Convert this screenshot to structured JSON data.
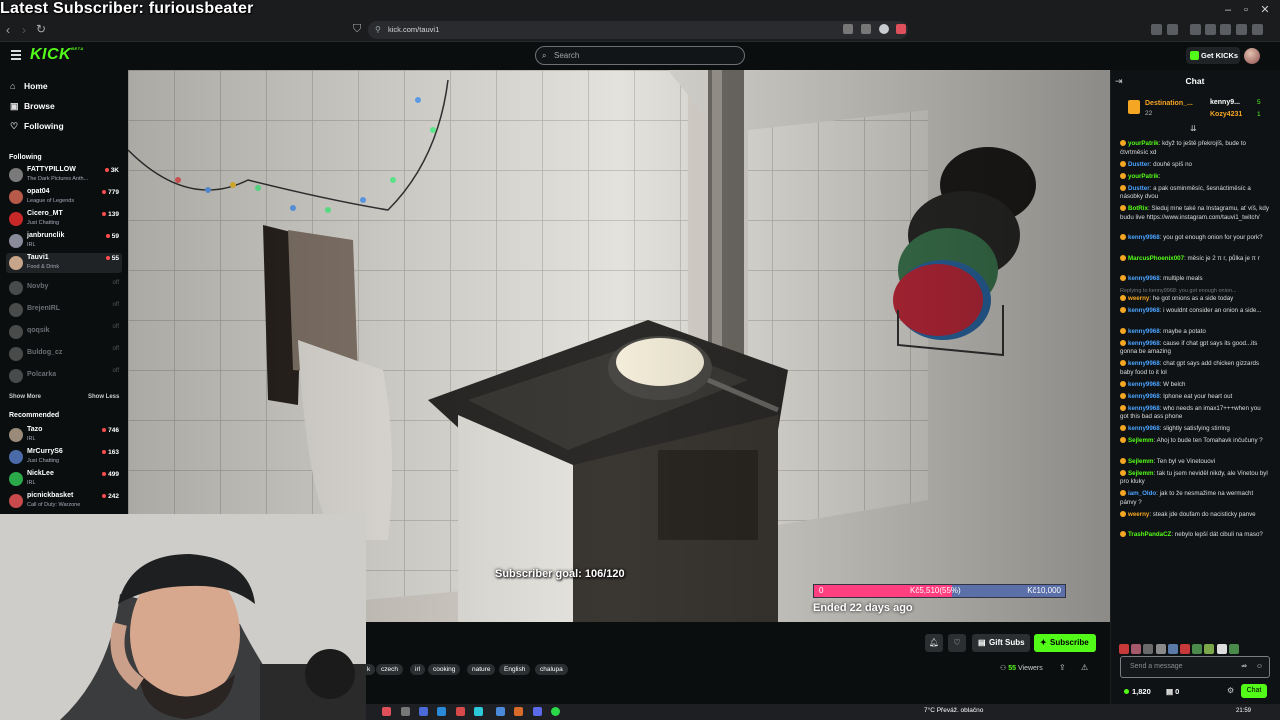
{
  "overlay": {
    "latest_subscriber": "Latest Subscriber: furiousbeater"
  },
  "browser": {
    "url": "kick.com/tauvi1"
  },
  "header": {
    "logo": "KICK",
    "search_placeholder": "Search",
    "get_kicks": "Get KICKs"
  },
  "sidebar": {
    "nav": [
      {
        "label": "Home",
        "icon": "home-icon"
      },
      {
        "label": "Browse",
        "icon": "browse-icon"
      },
      {
        "label": "Following",
        "icon": "heart-icon"
      }
    ],
    "following_title": "Following",
    "following": [
      {
        "name": "FATTYPILLOW",
        "category": "The Dark Pictures Anth...",
        "viewers": "3K",
        "color": "#7a7a7a"
      },
      {
        "name": "opat04",
        "category": "League of Legends",
        "viewers": "779",
        "color": "#b85a4a"
      },
      {
        "name": "Cicero_MT",
        "category": "Just Chatting",
        "viewers": "139",
        "color": "#c82828"
      },
      {
        "name": "janbrunclik",
        "category": "IRL",
        "viewers": "59",
        "color": "#8a8a9a"
      },
      {
        "name": "Tauvi1",
        "category": "Food & Drink",
        "viewers": "55",
        "color": "#c7a58a"
      }
    ],
    "offline": [
      {
        "name": "Novby",
        "status": "off"
      },
      {
        "name": "BrejenIRL",
        "status": "off"
      },
      {
        "name": "qoqsik",
        "status": "off"
      },
      {
        "name": "Buldog_cz",
        "status": "off"
      },
      {
        "name": "Polcarka",
        "status": "off"
      }
    ],
    "show_more": "Show More",
    "show_less": "Show Less",
    "recommended_title": "Recommended",
    "recommended": [
      {
        "name": "Tazo",
        "category": "IRL",
        "viewers": "746",
        "color": "#9a8a7a"
      },
      {
        "name": "MrCurryS6",
        "category": "Just Chatting",
        "viewers": "163",
        "color": "#4a6aa8"
      },
      {
        "name": "NickLee",
        "category": "IRL",
        "viewers": "499",
        "color": "#2aa84a"
      },
      {
        "name": "picnickbasket",
        "category": "Call of Duty: Warzone",
        "viewers": "242",
        "color": "#c84a4a"
      }
    ]
  },
  "stream": {
    "goal_text": "Subscriber goal: 106/120",
    "goal_progress": 0.55,
    "goal_start": "0",
    "goal_current": "Kč5,510(55%)",
    "goal_target": "Kč10,000",
    "goal_status": "Ended 22 days ago",
    "tags": [
      "k",
      "czech",
      "irl",
      "cooking",
      "nature",
      "English",
      "chalupa"
    ],
    "gift_subs": "Gift Subs",
    "subscribe": "Subscribe",
    "viewers": "55",
    "viewers_label": "Viewers"
  },
  "chat": {
    "title": "Chat",
    "pinned": {
      "user1": "Destination_...",
      "count1": "22",
      "user2": "kenny9...",
      "count2": "5",
      "user3": "Kozy4231",
      "count3": "1"
    },
    "messages": [
      {
        "user": "yourPatrik",
        "color": "#53fc18",
        "text": "když to ještě překrojíš, bude to čtvrtměsíc xd"
      },
      {
        "user": "Dustter",
        "color": "#4aa3ff",
        "text": "douhé spíš no"
      },
      {
        "user": "yourPatrik",
        "color": "#53fc18",
        "text": ""
      },
      {
        "user": "Dustter",
        "color": "#4aa3ff",
        "text": "a pak osminměsíc, šesnáctiměsíc a násobky dvou"
      },
      {
        "user": "BotRix",
        "color": "#53fc18",
        "text": "Sleduj mne také na Instagramu, ať víš, kdy budu live https://www.instagram.com/tauvi1_twitch/"
      },
      {
        "user": "kenny9968",
        "color": "#4aa3ff",
        "text": "you got enough onion for your pork?"
      },
      {
        "user": "MarcusPhoenix007",
        "color": "#53fc18",
        "text": "měsíc je 2 π r, půlka je π r"
      },
      {
        "user": "kenny9968",
        "color": "#4aa3ff",
        "text": "multiple meals"
      },
      {
        "user": "weerny",
        "color": "#f5a623",
        "text": "he got onions as a side today",
        "reply": "Replying to kenny9968: you got enough onion..."
      },
      {
        "user": "kenny9968",
        "color": "#4aa3ff",
        "text": "i wouldnt consider an onion a side..."
      },
      {
        "user": "kenny9968",
        "color": "#4aa3ff",
        "text": "maybe a potato"
      },
      {
        "user": "kenny9968",
        "color": "#4aa3ff",
        "text": "cause if chat gpt says its good...its gonna be amazing"
      },
      {
        "user": "kenny9968",
        "color": "#4aa3ff",
        "text": "chat gpt says add chicken gizzards baby food to it lol"
      },
      {
        "user": "kenny9968",
        "color": "#4aa3ff",
        "text": "W belch"
      },
      {
        "user": "kenny9968",
        "color": "#4aa3ff",
        "text": "Iphone eat your heart out"
      },
      {
        "user": "kenny9968",
        "color": "#4aa3ff",
        "text": "who needs an imax17+++when you got this bad ass phone"
      },
      {
        "user": "kenny9968",
        "color": "#4aa3ff",
        "text": "slightly satisfying stirring"
      },
      {
        "user": "Sejlemm",
        "color": "#53fc18",
        "text": "Ahoj to bude ten Tomahavk inčučuny ?"
      },
      {
        "user": "Sejlemm",
        "color": "#53fc18",
        "text": "Ten byl ve Vinetouovi"
      },
      {
        "user": "Sejlemm",
        "color": "#53fc18",
        "text": "tak tu jsem neviděl nikdy, ale Vinetou byl pro kluky"
      },
      {
        "user": "iam_Oldo",
        "color": "#4aa3ff",
        "text": "jak to že nesmažime na wermacht pánvy ?"
      },
      {
        "user": "weerny",
        "color": "#f5a623",
        "text": "steak jde doufam do nacisticky panve"
      },
      {
        "user": "TrashPandaCZ",
        "color": "#53fc18",
        "text": "nebylo lepší dát cibuli na maso?"
      }
    ],
    "input_placeholder": "Send a message",
    "kicks": "1,820",
    "gifts": "0",
    "send": "Chat"
  },
  "taskbar": {
    "weather": "7°C  Převáž. oblačno",
    "clock": "21:59"
  }
}
